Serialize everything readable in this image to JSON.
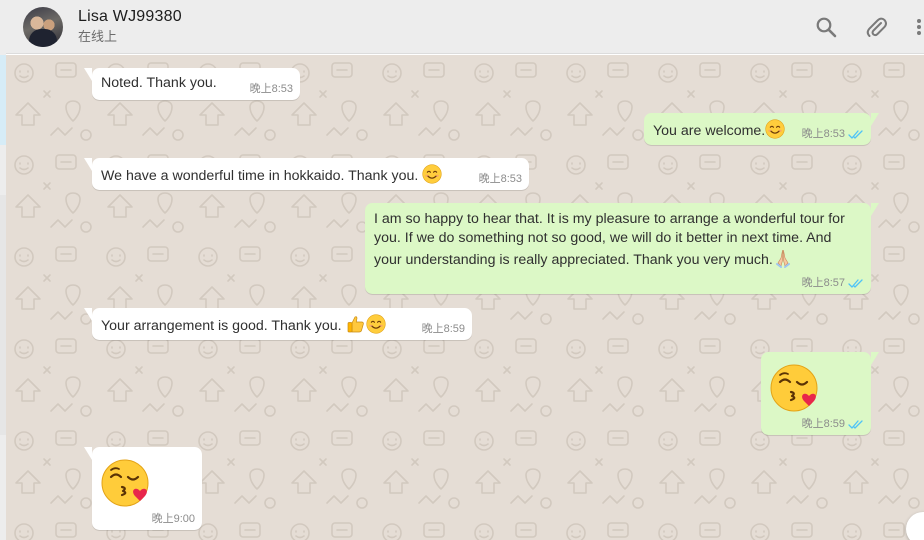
{
  "header": {
    "contact_name": "Lisa WJ99380",
    "status": "在线上",
    "icons": [
      "avatar",
      "search-icon",
      "attach-icon",
      "menu-icon"
    ]
  },
  "messages": [
    {
      "direction": "in",
      "text": "Noted. Thank you.",
      "time": "晚上8:53"
    },
    {
      "direction": "out",
      "text": "You are welcome.",
      "emoji": [
        "smiling-face"
      ],
      "time": "晚上8:53",
      "status": "read"
    },
    {
      "direction": "in",
      "text": "We have a wonderful time in hokkaido. Thank you.",
      "emoji": [
        "smiling-face"
      ],
      "time": "晚上8:53"
    },
    {
      "direction": "out",
      "text": "I am so happy to hear that. It is my pleasure to arrange a wonderful tour for you. If we do something not so good, we will do it better in next time. And your understanding is really appreciated. Thank you very much.",
      "emoji": [
        "folded-hands"
      ],
      "time": "晚上8:57",
      "status": "read"
    },
    {
      "direction": "in",
      "text": "Your arrangement is good. Thank you.",
      "emoji": [
        "thumbs-up",
        "smiling-face"
      ],
      "time": "晚上8:59"
    },
    {
      "direction": "out",
      "text": "",
      "emoji": [
        "face-blowing-a-kiss"
      ],
      "time": "晚上8:59",
      "status": "read"
    },
    {
      "direction": "in",
      "text": "",
      "emoji": [
        "face-blowing-a-kiss"
      ],
      "time": "晚上9:00"
    }
  ],
  "colors": {
    "header_bg": "#ededed",
    "chat_bg": "#e5ddd5",
    "incoming_bubble": "#ffffff",
    "outgoing_bubble": "#dcf8c6",
    "read_ticks": "#4fc3f7"
  }
}
